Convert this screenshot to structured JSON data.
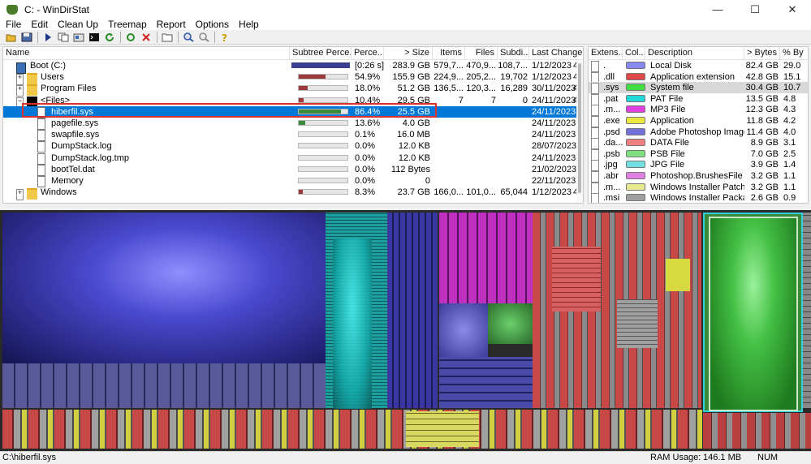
{
  "window": {
    "title": "C: - WinDirStat",
    "min": "—",
    "max": "☐",
    "close": "✕"
  },
  "menu": [
    "File",
    "Edit",
    "Clean Up",
    "Treemap",
    "Report",
    "Options",
    "Help"
  ],
  "toolbar_icons": [
    "open-icon",
    "save-icon",
    "play-icon",
    "copy-icon",
    "explorer-icon",
    "cmd-icon",
    "refresh-icon",
    "refresh-all-icon",
    "delete-icon",
    "folder-icon",
    "zoom-in-icon",
    "zoom-out-icon",
    "help-icon"
  ],
  "tree": {
    "columns": [
      "Name",
      "Subtree Perce...",
      "Perce...",
      "> Size",
      "Items",
      "Files",
      "Subdi...",
      "Last Change"
    ],
    "rows": [
      {
        "name": "Boot (C:)",
        "pct": "[0:26 s]",
        "size": "283.9 GB",
        "items": "579,7...",
        "files": "470,9...",
        "subdirs": "108,7...",
        "date": "1/12/2023",
        "extra": "4",
        "bar": 1.0,
        "bar_color": "#3a3f8f"
      },
      {
        "name": "Users",
        "pct": "54.9%",
        "size": "155.9 GB",
        "items": "224,9...",
        "files": "205,2...",
        "subdirs": "19,702",
        "date": "1/12/2023",
        "extra": "4",
        "bar": 0.549,
        "bar_color": "#9a3a3a"
      },
      {
        "name": "Program Files",
        "pct": "18.0%",
        "size": "51.2 GB",
        "items": "136,5...",
        "files": "120,3...",
        "subdirs": "16,289",
        "date": "30/11/2023",
        "extra": "4",
        "bar": 0.18,
        "bar_color": "#9a3a3a"
      },
      {
        "name": "<Files>",
        "pct": "10.4%",
        "size": "29.5 GB",
        "items": "7",
        "files": "7",
        "subdirs": "0",
        "date": "24/11/2023",
        "extra": "4",
        "bar": 0.104,
        "bar_color": "#9a3a3a"
      },
      {
        "name": "hiberfil.sys",
        "pct": "86.4%",
        "size": "25.5 GB",
        "items": "",
        "files": "",
        "subdirs": "",
        "date": "24/11/2023",
        "extra": "",
        "bar": 0.864,
        "bar_color": "#3a8a3a"
      },
      {
        "name": "pagefile.sys",
        "pct": "13.6%",
        "size": "4.0 GB",
        "items": "",
        "files": "",
        "subdirs": "",
        "date": "24/11/2023",
        "extra": "",
        "bar": 0.136,
        "bar_color": "#3a8a3a"
      },
      {
        "name": "swapfile.sys",
        "pct": "0.1%",
        "size": "16.0 MB",
        "items": "",
        "files": "",
        "subdirs": "",
        "date": "24/11/2023",
        "extra": "",
        "bar": 0.001,
        "bar_color": "#3a8a3a"
      },
      {
        "name": "DumpStack.log",
        "pct": "0.0%",
        "size": "12.0 KB",
        "items": "",
        "files": "",
        "subdirs": "",
        "date": "28/07/2023",
        "extra": "",
        "bar": 0.0,
        "bar_color": "#3a8a3a"
      },
      {
        "name": "DumpStack.log.tmp",
        "pct": "0.0%",
        "size": "12.0 KB",
        "items": "",
        "files": "",
        "subdirs": "",
        "date": "24/11/2023",
        "extra": "",
        "bar": 0.0,
        "bar_color": "#3a8a3a"
      },
      {
        "name": "bootTel.dat",
        "pct": "0.0%",
        "size": "112 Bytes",
        "items": "",
        "files": "",
        "subdirs": "",
        "date": "21/02/2023",
        "extra": "",
        "bar": 0.0,
        "bar_color": "#3a8a3a"
      },
      {
        "name": "Memory",
        "pct": "0.0%",
        "size": "0",
        "items": "",
        "files": "",
        "subdirs": "",
        "date": "22/11/2023",
        "extra": "",
        "bar": 0.0,
        "bar_color": "#3a8a3a"
      },
      {
        "name": "Windows",
        "pct": "8.3%",
        "size": "23.7 GB",
        "items": "166,0...",
        "files": "101,0...",
        "subdirs": "65,044",
        "date": "1/12/2023",
        "extra": "4",
        "bar": 0.083,
        "bar_color": "#9a3a3a"
      }
    ]
  },
  "extensions": {
    "columns": [
      "Extens...",
      "Col...",
      "Description",
      "> Bytes",
      "% By"
    ],
    "rows": [
      {
        "ext": ".",
        "color": "#8888ee",
        "desc": "Local Disk",
        "bytes": "82.4 GB",
        "pct": "29.0"
      },
      {
        "ext": ".dll",
        "color": "#e04848",
        "desc": "Application extension",
        "bytes": "42.8 GB",
        "pct": "15.1"
      },
      {
        "ext": ".sys",
        "color": "#44dd44",
        "desc": "System file",
        "bytes": "30.4 GB",
        "pct": "10.7"
      },
      {
        "ext": ".pat",
        "color": "#22d8d8",
        "desc": "PAT File",
        "bytes": "13.5 GB",
        "pct": "4.8"
      },
      {
        "ext": ".m...",
        "color": "#e040e0",
        "desc": "MP3 File",
        "bytes": "12.3 GB",
        "pct": "4.3"
      },
      {
        "ext": ".exe",
        "color": "#e8e840",
        "desc": "Application",
        "bytes": "11.8 GB",
        "pct": "4.2"
      },
      {
        "ext": ".psd",
        "color": "#7070d8",
        "desc": "Adobe Photoshop Image...",
        "bytes": "11.4 GB",
        "pct": "4.0"
      },
      {
        "ext": ".da...",
        "color": "#f08080",
        "desc": "DATA File",
        "bytes": "8.9 GB",
        "pct": "3.1"
      },
      {
        "ext": ".psb",
        "color": "#80e080",
        "desc": "PSB File",
        "bytes": "7.0 GB",
        "pct": "2.5"
      },
      {
        "ext": ".jpg",
        "color": "#70e0e0",
        "desc": "JPG File",
        "bytes": "3.9 GB",
        "pct": "1.4"
      },
      {
        "ext": ".abr",
        "color": "#e080e0",
        "desc": "Photoshop.BrushesFile",
        "bytes": "3.2 GB",
        "pct": "1.1"
      },
      {
        "ext": ".m...",
        "color": "#e8e890",
        "desc": "Windows Installer Patch",
        "bytes": "3.2 GB",
        "pct": "1.1"
      },
      {
        "ext": ".msi",
        "color": "#a0a0a0",
        "desc": "Windows Installer Package",
        "bytes": "2.6 GB",
        "pct": "0.9"
      }
    ]
  },
  "status": {
    "path": "C:\\hiberfil.sys",
    "ram_label": "RAM Usage:",
    "ram_value": "146.1 MB",
    "num": "NUM"
  }
}
